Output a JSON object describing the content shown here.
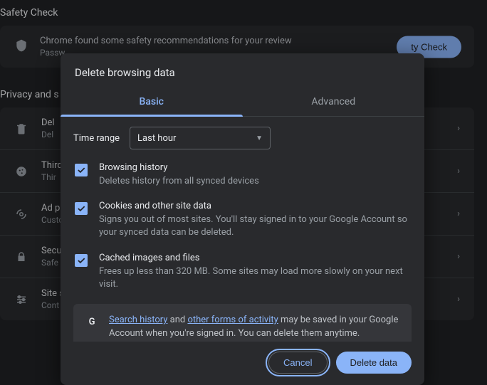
{
  "bg": {
    "safety_section": "Safety Check",
    "safety_card": {
      "title": "Chrome found some safety recommendations for your review",
      "sub": "Passw",
      "button": "ty Check"
    },
    "privacy_section": "Privacy and s",
    "rows": [
      {
        "title": "Del",
        "sub": "Del"
      },
      {
        "title": "Third",
        "sub": "Thir"
      },
      {
        "title": "Ad p",
        "sub": "Custo"
      },
      {
        "title": "Secu",
        "sub": "Safe"
      },
      {
        "title": "Site s",
        "sub": "Cont"
      }
    ]
  },
  "dialog": {
    "title": "Delete browsing data",
    "tabs": {
      "basic": "Basic",
      "advanced": "Advanced"
    },
    "time_range_label": "Time range",
    "time_range_value": "Last hour",
    "options": [
      {
        "heading": "Browsing history",
        "desc": "Deletes history from all synced devices",
        "checked": true
      },
      {
        "heading": "Cookies and other site data",
        "desc": "Signs you out of most sites. You'll stay signed in to your Google Account so your synced data can be deleted.",
        "checked": true
      },
      {
        "heading": "Cached images and files",
        "desc": "Frees up less than 320 MB. Some sites may load more slowly on your next visit.",
        "checked": true
      }
    ],
    "info": {
      "link1": "Search history",
      "mid1": " and ",
      "link2": "other forms of activity",
      "tail": " may be saved in your Google Account when you're signed in. You can delete them anytime."
    },
    "buttons": {
      "cancel": "Cancel",
      "delete": "Delete data"
    }
  }
}
